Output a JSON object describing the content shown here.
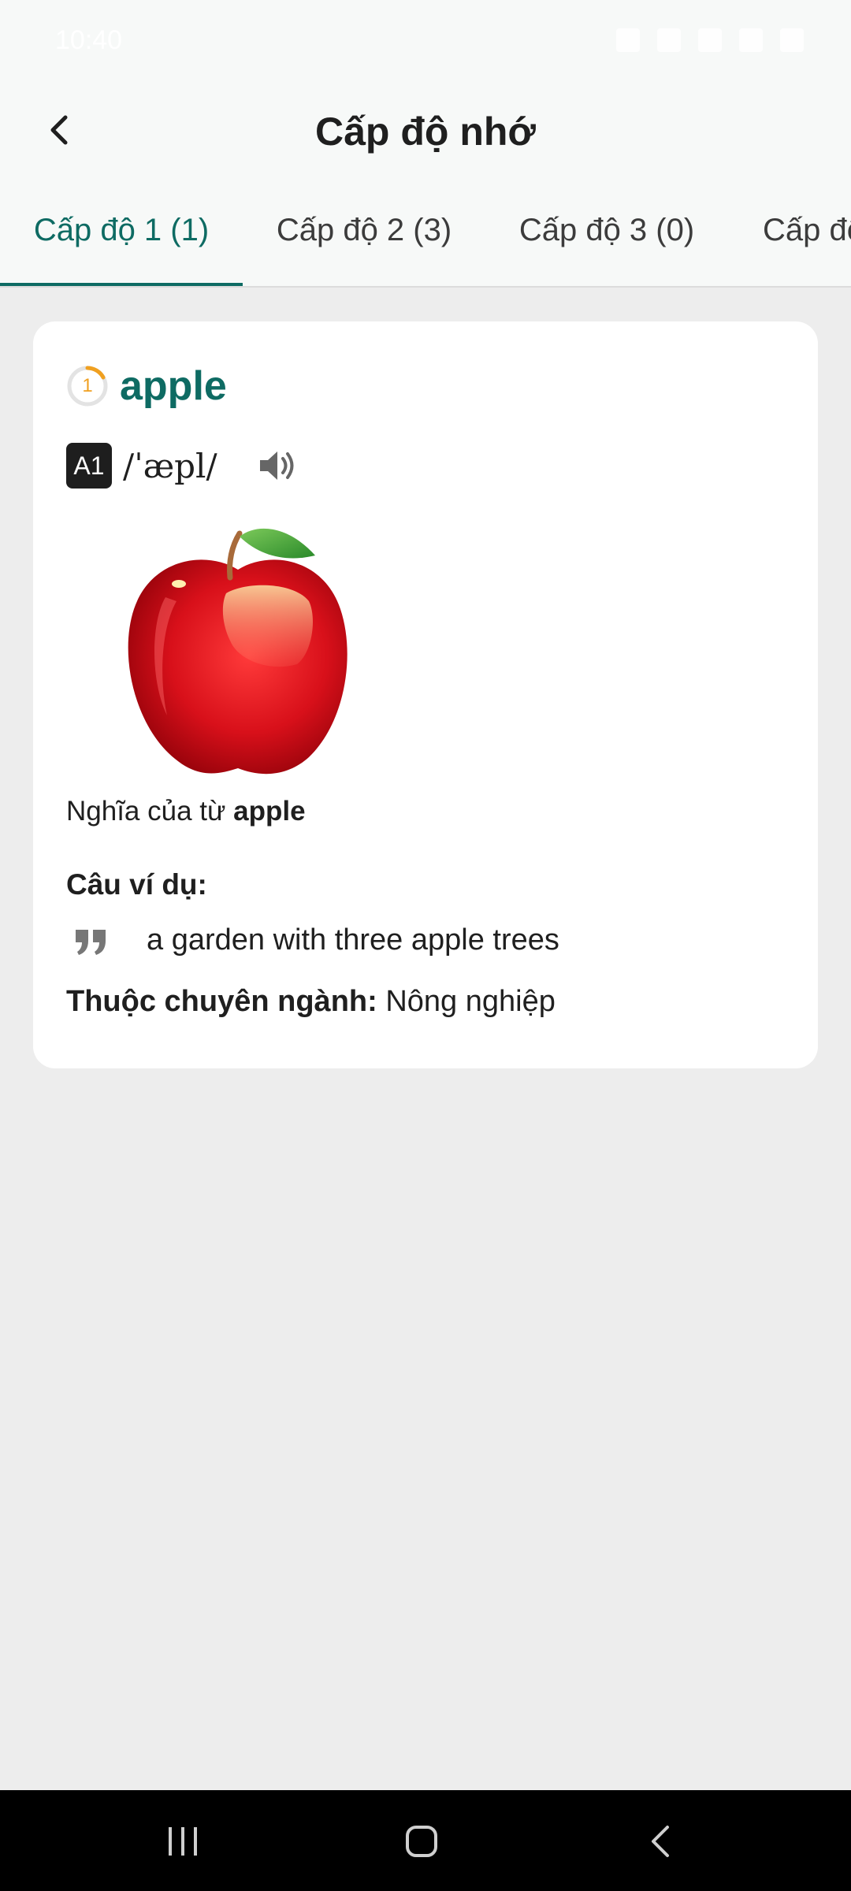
{
  "status_bar": {
    "time": "10:40"
  },
  "header": {
    "title": "Cấp độ nhớ"
  },
  "tabs": [
    {
      "label": "Cấp độ 1 (1)",
      "active": true
    },
    {
      "label": "Cấp độ 2 (3)",
      "active": false
    },
    {
      "label": "Cấp độ 3 (0)",
      "active": false
    },
    {
      "label": "Cấp độ",
      "active": false
    }
  ],
  "card": {
    "level_number": "1",
    "word": "apple",
    "cefr_badge": "A1",
    "ipa": "/ˈæpl/",
    "meaning_prefix": "Nghĩa của từ ",
    "meaning_word": "apple",
    "example_title": "Câu ví dụ:",
    "example_sentence": "a garden with three apple trees",
    "field_label": "Thuộc chuyên ngành:",
    "field_value": " Nông nghiệp"
  },
  "colors": {
    "accent": "#0e6b63",
    "level_ring": "#f0a020",
    "background": "#ededed"
  },
  "icons": [
    "back-arrow-icon",
    "level-ring-icon",
    "speaker-icon",
    "quote-icon",
    "recent-apps-icon",
    "home-icon",
    "nav-back-icon"
  ]
}
